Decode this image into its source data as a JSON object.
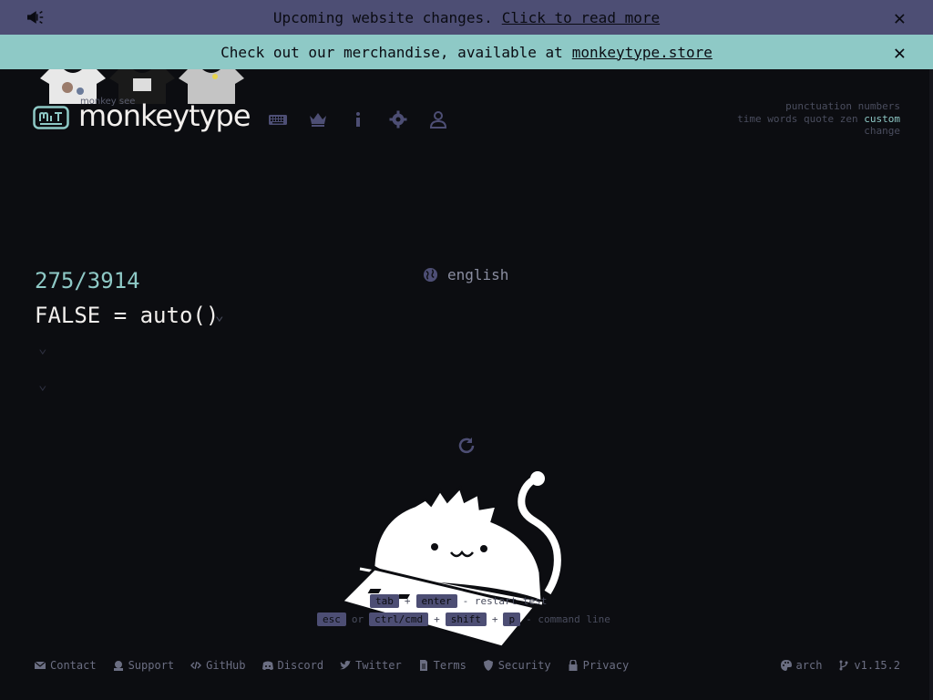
{
  "banners": {
    "announcement_text": "Upcoming website changes.",
    "announcement_link": "Click to read more",
    "merch_text": "Check out our merchandise, available at",
    "merch_link": "monkeytype.store",
    "close_symbol": "✕"
  },
  "logo": {
    "subtitle": "monkey see",
    "title": "monkeytype"
  },
  "nav": {
    "icons": [
      "keyboard-icon",
      "crown-icon",
      "info-icon",
      "gear-icon",
      "user-icon"
    ]
  },
  "config": {
    "row1": [
      "punctuation",
      "numbers"
    ],
    "row2": [
      "time",
      "words",
      "quote",
      "zen",
      "custom"
    ],
    "row3": "change",
    "active": "custom"
  },
  "test": {
    "language": "english",
    "progress": "275/3914",
    "words": "FALSE = auto()"
  },
  "hints": {
    "key_tab": "tab",
    "plus1": "+",
    "key_enter": "enter",
    "action1": "- restart test",
    "key_esc": "esc",
    "or": "or",
    "key_ctrl": "ctrl/cmd",
    "plus2": "+",
    "key_shift": "shift",
    "plus3": "+",
    "key_p": "p",
    "action2": "- command line"
  },
  "footer": {
    "links": [
      "Contact",
      "Support",
      "GitHub",
      "Discord",
      "Twitter",
      "Terms",
      "Security",
      "Privacy"
    ],
    "theme": "arch",
    "version": "v1.15.2"
  },
  "colors": {
    "background": "#0c0d11",
    "accent": "#8ec9c6",
    "sub": "#4d4e74",
    "text": "#f2efed"
  }
}
